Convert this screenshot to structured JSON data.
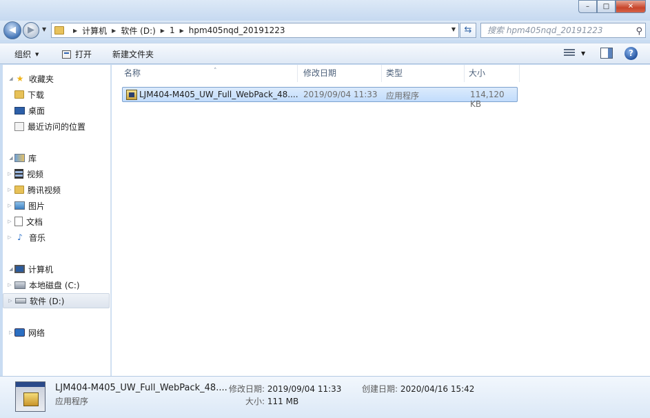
{
  "window": {
    "minimize": "–",
    "maximize": "□",
    "close": "✕"
  },
  "address": {
    "crumbs": [
      "计算机",
      "软件 (D:)",
      "1",
      "hpm405nqd_20191223"
    ],
    "search_placeholder": "搜索 hpm405nqd_20191223"
  },
  "toolbar": {
    "organize": "组织",
    "open": "打开",
    "new_folder": "新建文件夹",
    "help": "?"
  },
  "nav": {
    "favorites": "收藏夹",
    "fav_items": [
      "下载",
      "桌面",
      "最近访问的位置"
    ],
    "libraries": "库",
    "lib_items": [
      "视频",
      "腾讯视频",
      "图片",
      "文档",
      "音乐"
    ],
    "computer": "计算机",
    "drives": [
      "本地磁盘 (C:)",
      "软件 (D:)"
    ],
    "network": "网络"
  },
  "columns": [
    "名称",
    "修改日期",
    "类型",
    "大小"
  ],
  "files": [
    {
      "name": "LJM404-M405_UW_Full_WebPack_48....",
      "date": "2019/09/04 11:33",
      "type": "应用程序",
      "size": "114,120 KB"
    }
  ],
  "details": {
    "name": "LJM404-M405_UW_Full_WebPack_48....",
    "type": "应用程序",
    "modified_label": "修改日期:",
    "modified": "2019/09/04 11:33",
    "created_label": "创建日期:",
    "created": "2020/04/16 15:42",
    "size_label": "大小:",
    "size": "111 MB"
  }
}
